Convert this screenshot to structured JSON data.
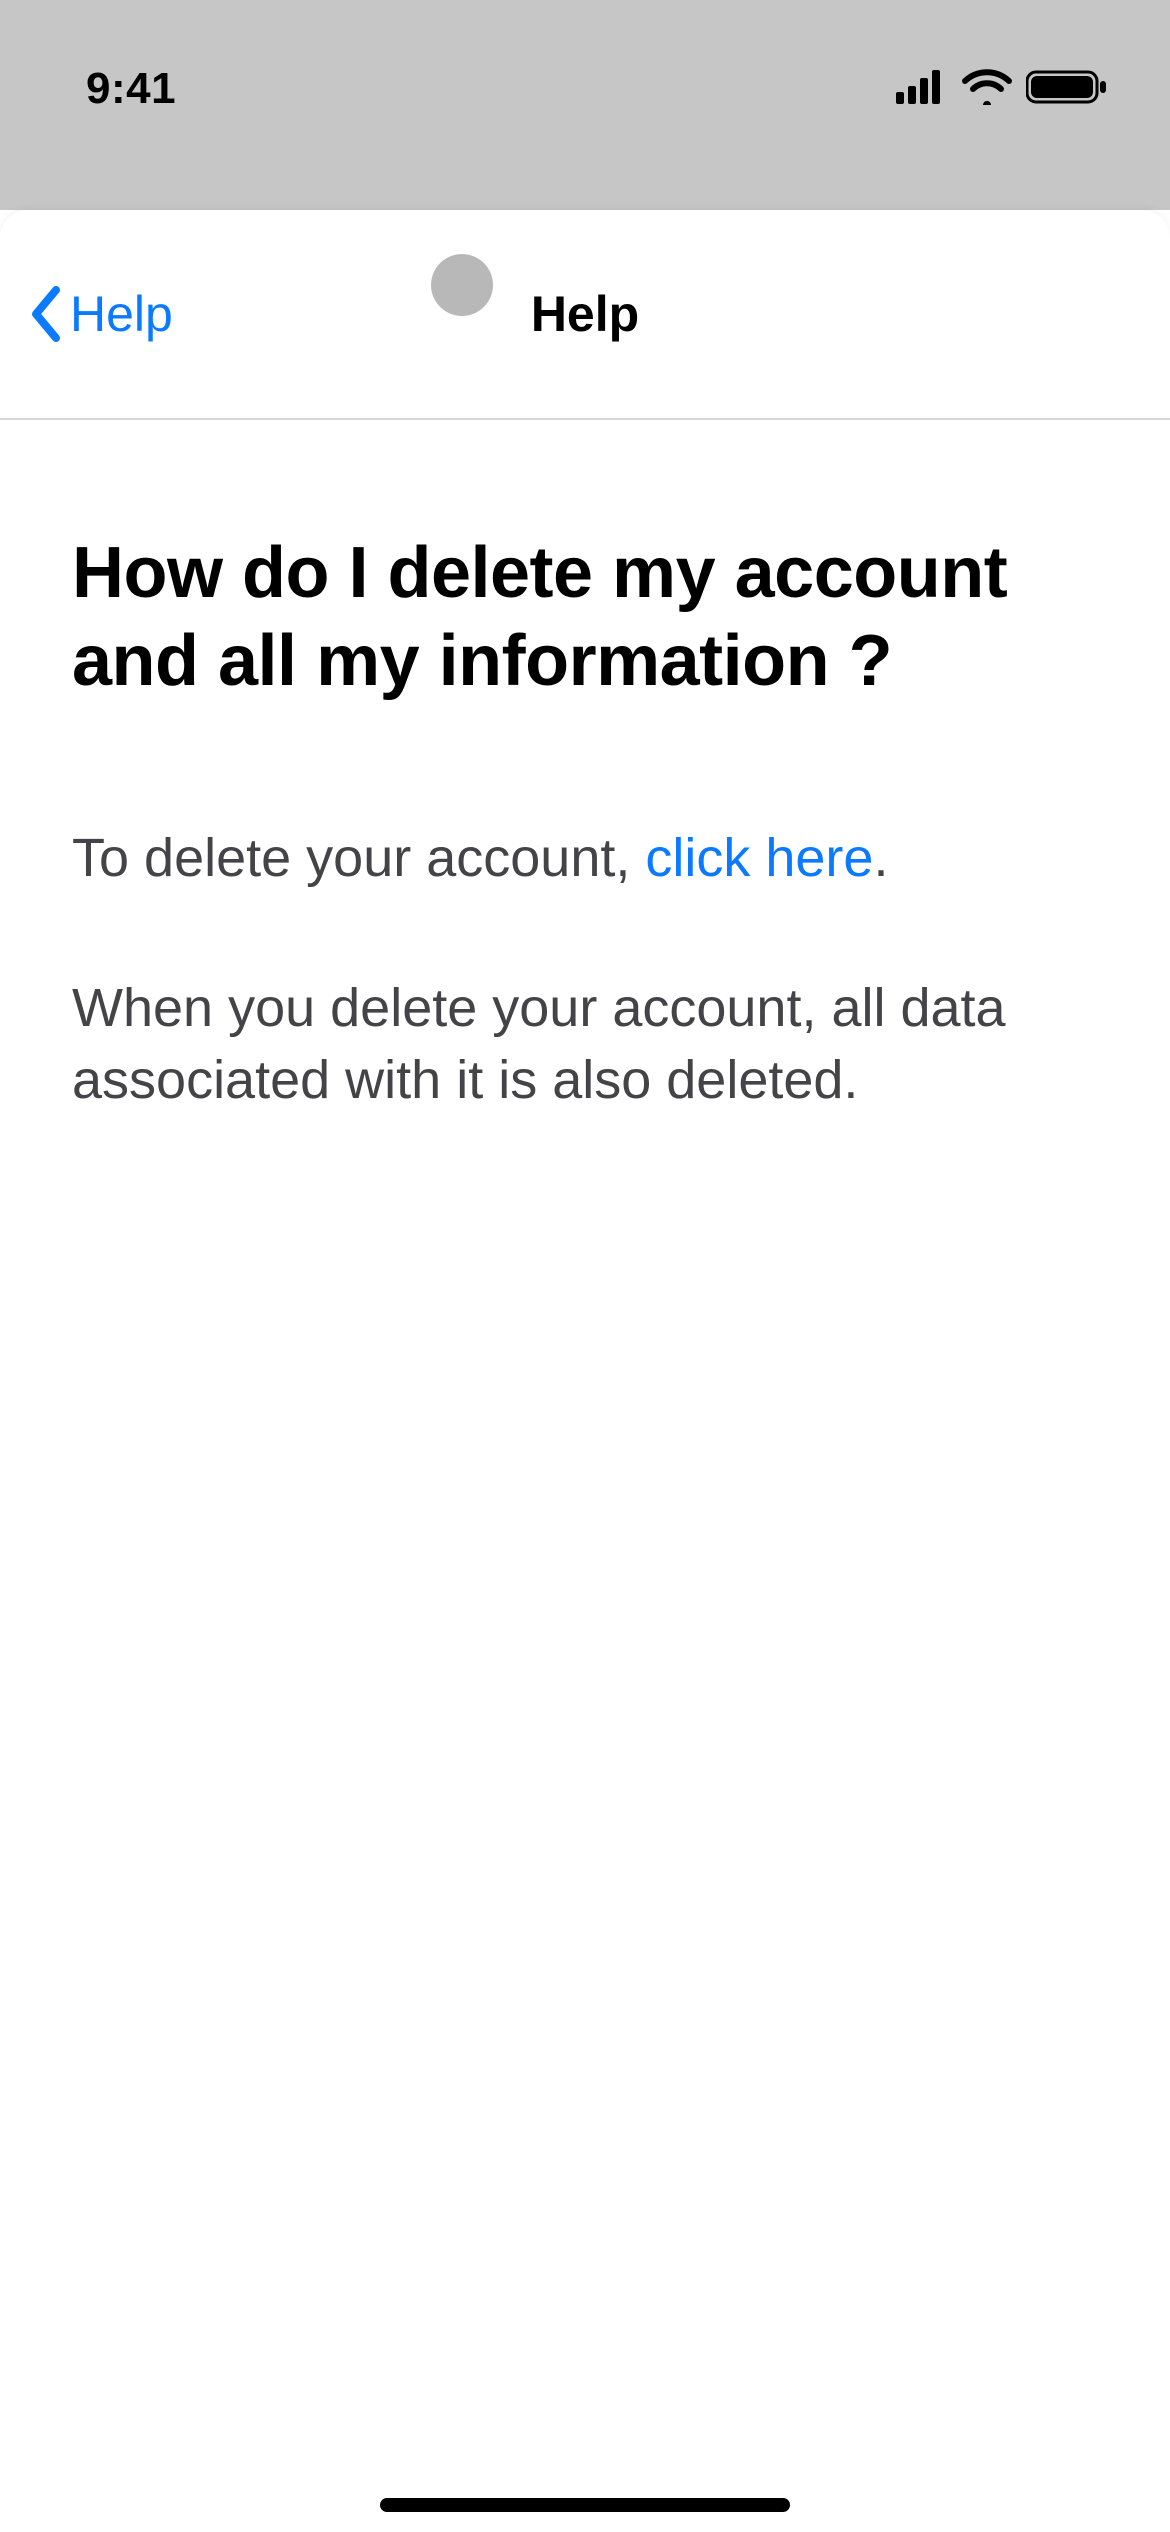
{
  "status": {
    "time": "9:41"
  },
  "nav": {
    "back_label": "Help",
    "title": "Help"
  },
  "article": {
    "heading": "How do I delete my account and all my information ?",
    "p1_prefix": "To delete your account, ",
    "p1_link": "click here",
    "p1_suffix": ".",
    "p2": "When you delete your account, all data associated with it is also deleted."
  }
}
